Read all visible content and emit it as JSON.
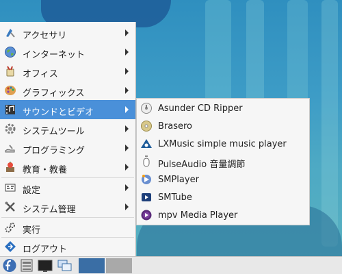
{
  "desktop": {
    "background_color": "#3d9cc6"
  },
  "menu": {
    "items": [
      {
        "label": "アクセサリ",
        "icon": "accessories-icon",
        "submenu": true
      },
      {
        "label": "インターネット",
        "icon": "globe-icon",
        "submenu": true
      },
      {
        "label": "オフィス",
        "icon": "office-icon",
        "submenu": true
      },
      {
        "label": "グラフィックス",
        "icon": "palette-icon",
        "submenu": true
      },
      {
        "label": "サウンドとビデオ",
        "icon": "multimedia-icon",
        "submenu": true,
        "active": true
      },
      {
        "label": "システムツール",
        "icon": "gear-icon",
        "submenu": true
      },
      {
        "label": "プログラミング",
        "icon": "programming-icon",
        "submenu": true
      },
      {
        "label": "教育・教養",
        "icon": "education-icon",
        "submenu": true
      },
      {
        "label": "設定",
        "icon": "preferences-icon",
        "submenu": true
      },
      {
        "label": "システム管理",
        "icon": "tools-icon",
        "submenu": true
      },
      {
        "label": "実行",
        "icon": "run-icon",
        "submenu": false
      },
      {
        "label": "ログアウト",
        "icon": "logout-icon",
        "submenu": false
      }
    ]
  },
  "submenu": {
    "items": [
      {
        "label": "Asunder CD Ripper",
        "icon": "cd-ripper-icon"
      },
      {
        "label": "Brasero",
        "icon": "disc-burner-icon"
      },
      {
        "label": "LXMusic simple music player",
        "icon": "music-player-icon"
      },
      {
        "label": "PulseAudio 音量調節",
        "icon": "volume-control-icon"
      },
      {
        "label": "SMPlayer",
        "icon": "smplayer-icon"
      },
      {
        "label": "SMTube",
        "icon": "smtube-icon"
      },
      {
        "label": "mpv Media Player",
        "icon": "mpv-icon"
      }
    ]
  },
  "panel": {
    "buttons": [
      {
        "icon": "start-menu-icon"
      },
      {
        "icon": "file-manager-icon"
      },
      {
        "icon": "terminal-icon"
      },
      {
        "icon": "window-switcher-icon"
      }
    ],
    "accent_color": "#4a90d9",
    "workspace_active_color": "#3a6ea5",
    "workspace_inactive_color": "#a9a9a9"
  }
}
